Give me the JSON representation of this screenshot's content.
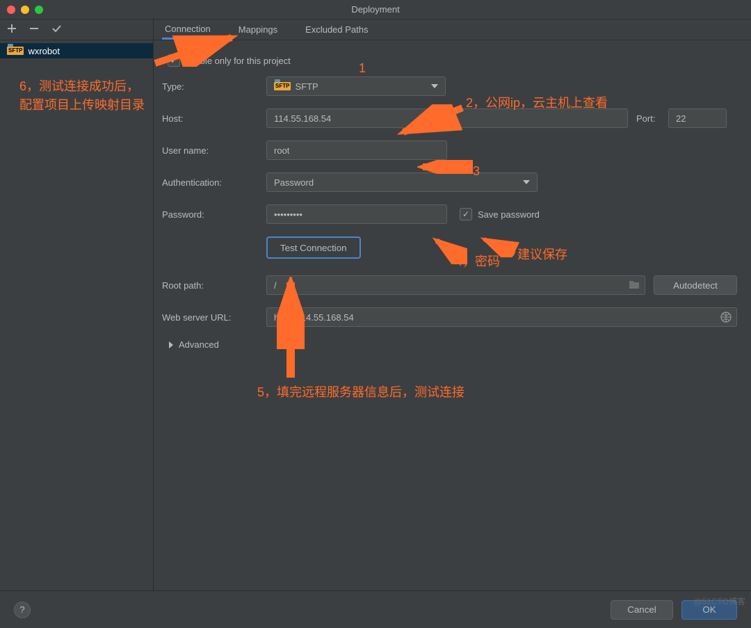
{
  "window": {
    "title": "Deployment"
  },
  "sidebar": {
    "item": "wxrobot",
    "badge": "SFTP"
  },
  "tabs": {
    "connection": "Connection",
    "mappings": "Mappings",
    "excluded": "Excluded Paths"
  },
  "form": {
    "visible_label": "Visible only for this project",
    "type_label": "Type:",
    "type_value": "SFTP",
    "host_label": "Host:",
    "host_value": "114.55.168.54",
    "port_label": "Port:",
    "port_value": "22",
    "user_label": "User name:",
    "user_value": "root",
    "auth_label": "Authentication:",
    "auth_value": "Password",
    "pass_label": "Password:",
    "pass_value": "•••••••••",
    "save_pass_label": "Save password",
    "test_btn": "Test Connection",
    "root_label": "Root path:",
    "root_value": "/",
    "auto_btn": "Autodetect",
    "url_label": "Web server URL:",
    "url_value": "http://114.55.168.54",
    "advanced": "Advanced"
  },
  "footer": {
    "help": "?",
    "cancel": "Cancel",
    "ok": "OK"
  },
  "annotations": {
    "a1": "1",
    "a2": "2，公网ip，云主机上查看",
    "a3": "3",
    "a4": "4，密码",
    "a4b": "建议保存",
    "a5": "5，填完远程服务器信息后，测试连接",
    "a6a": "6，测试连接成功后，",
    "a6b": "配置项目上传映射目录"
  },
  "watermark": "@51CTO博客"
}
